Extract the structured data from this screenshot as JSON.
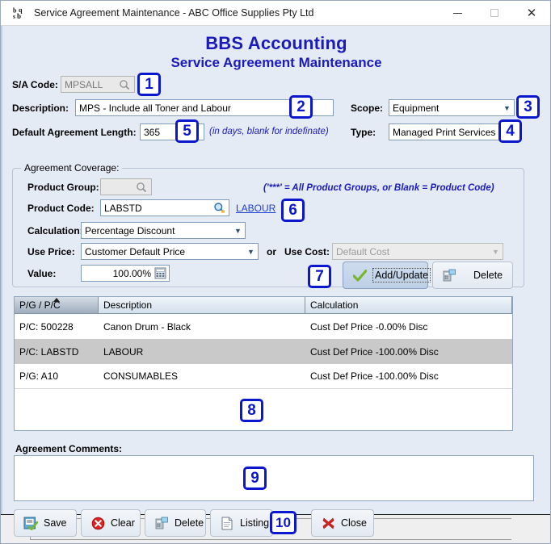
{
  "window": {
    "icon_name": "bbs-app-icon",
    "title": "Service Agreement Maintenance - ABC Office Supplies Pty Ltd",
    "minimize_label": "—",
    "maximize_label": "□",
    "close_label": "✕"
  },
  "heading": {
    "line1": "BBS Accounting",
    "line2": "Service Agreement Maintenance",
    "color": "#1b1bbb"
  },
  "form": {
    "sa_code_label": "S/A Code:",
    "sa_code_value": "MPSALL",
    "description_label": "Description:",
    "description_value": "MPS - Include all Toner and Labour",
    "agreement_length_label": "Default Agreement Length:",
    "agreement_length_value": "365",
    "agreement_length_hint": "(in days, blank for indefinate)",
    "scope_label": "Scope:",
    "scope_value": "Equipment",
    "type_label": "Type:",
    "type_value": "Managed Print Services"
  },
  "coverage": {
    "group_title": "Agreement Coverage:",
    "product_group_label": "Product Group:",
    "product_group_value": "",
    "product_code_label": "Product Code:",
    "product_code_value": "LABSTD",
    "product_code_link": "LABOUR",
    "wildcard_hint": "('***' = All Product Groups, or Blank = Product Code)",
    "calculation_label": "Calculation:",
    "calculation_value": "Percentage Discount",
    "use_price_label": "Use Price:",
    "use_price_value": "Customer Default Price",
    "or_label": "or",
    "use_cost_label": "Use Cost:",
    "use_cost_value": "Default Cost",
    "value_label": "Value:",
    "value_value": "100.00%",
    "add_update_label": "Add/Update",
    "delete_label": "Delete"
  },
  "grid": {
    "columns": [
      "P/G / P/C",
      "Description",
      "Calculation"
    ],
    "sorted_column": 0,
    "rows": [
      {
        "pgpc": "P/C: 500228",
        "description": "Canon Drum - Black",
        "calculation": "Cust Def Price -0.00% Disc"
      },
      {
        "pgpc": "P/C: LABSTD",
        "description": "LABOUR",
        "calculation": "Cust Def Price -100.00% Disc"
      },
      {
        "pgpc": "P/G: A10",
        "description": "CONSUMABLES",
        "calculation": "Cust Def Price -100.00% Disc"
      }
    ]
  },
  "comments": {
    "label": "Agreement Comments:",
    "value": ""
  },
  "footer": {
    "buttons": [
      {
        "label": "Save",
        "icon": "save-icon"
      },
      {
        "label": "Clear",
        "icon": "clear-icon"
      },
      {
        "label": "Delete",
        "icon": "delete-icon"
      },
      {
        "label": "Listing",
        "icon": "listing-icon"
      },
      {
        "label": "Close",
        "icon": "close-x-icon"
      }
    ]
  },
  "callouts": [
    {
      "n": "1"
    },
    {
      "n": "2"
    },
    {
      "n": "3"
    },
    {
      "n": "4"
    },
    {
      "n": "5"
    },
    {
      "n": "6"
    },
    {
      "n": "7"
    },
    {
      "n": "8"
    },
    {
      "n": "9"
    },
    {
      "n": "10"
    }
  ]
}
